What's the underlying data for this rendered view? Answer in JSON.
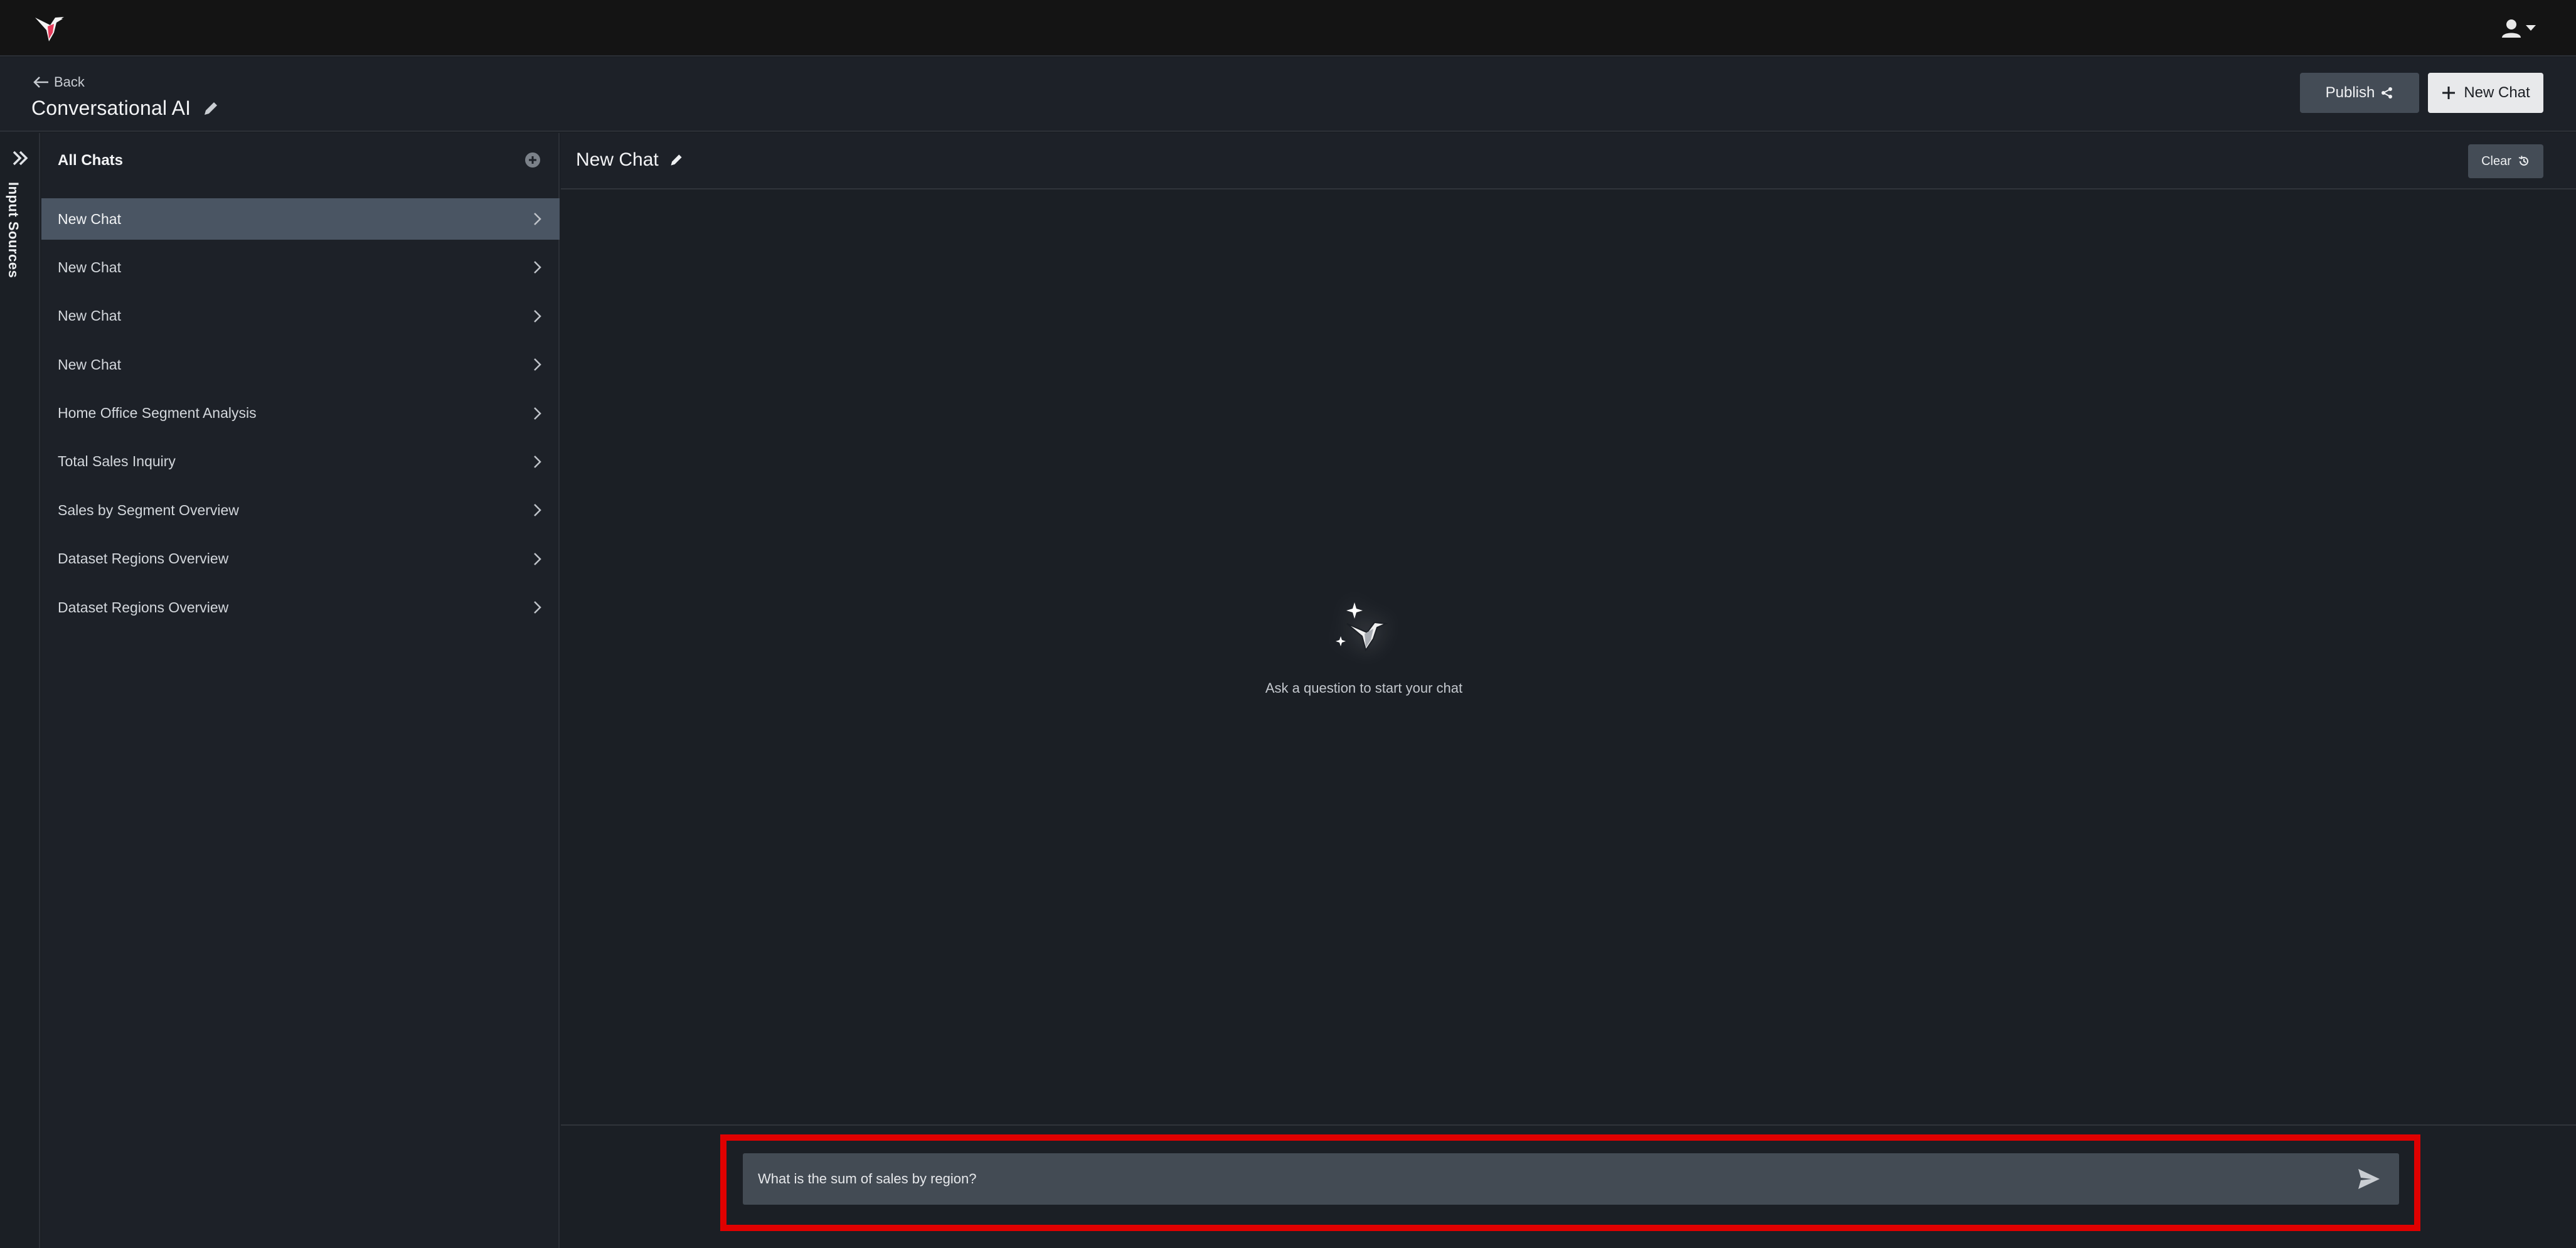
{
  "header": {
    "back_label": "Back",
    "title": "Conversational AI",
    "publish_label": "Publish",
    "new_chat_label": "New Chat"
  },
  "rail": {
    "label": "Input Sources"
  },
  "sidebar": {
    "title": "All Chats",
    "items": [
      {
        "label": "New Chat",
        "active": true
      },
      {
        "label": "New Chat",
        "active": false
      },
      {
        "label": "New Chat",
        "active": false
      },
      {
        "label": "New Chat",
        "active": false
      },
      {
        "label": "Home Office Segment Analysis",
        "active": false
      },
      {
        "label": "Total Sales Inquiry",
        "active": false
      },
      {
        "label": "Sales by Segment Overview",
        "active": false
      },
      {
        "label": "Dataset Regions Overview",
        "active": false
      },
      {
        "label": "Dataset Regions Overview",
        "active": false
      }
    ]
  },
  "chat": {
    "title": "New Chat",
    "clear_label": "Clear",
    "empty_message": "Ask a question to start your chat",
    "input_value": "What is the sum of sales by region?"
  },
  "icons": {
    "logo": "hummingbird-logo-icon",
    "user": "user-icon",
    "edit": "pencil-icon",
    "share": "share-icon",
    "plus": "plus-icon",
    "expand": "double-chevron-right-icon",
    "add": "add-circle-icon",
    "chevron": "chevron-right-icon",
    "clear": "history-icon",
    "send": "send-icon"
  },
  "colors": {
    "highlight": "#e00000",
    "active_item": "#4a5563",
    "logo_accent": "#e63b5a"
  }
}
